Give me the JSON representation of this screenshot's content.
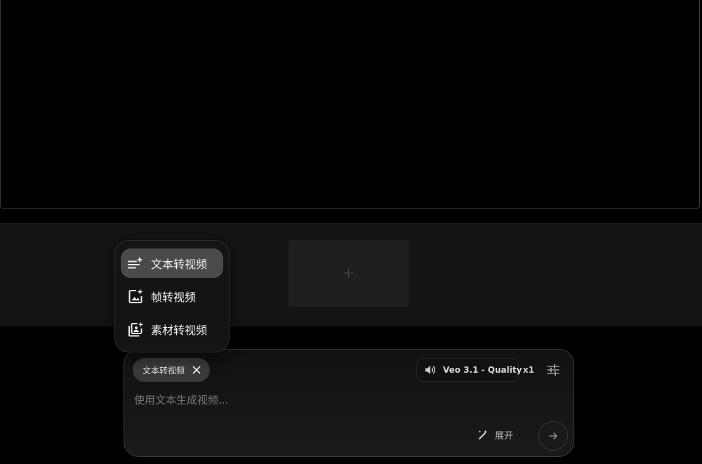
{
  "timeline": {
    "add_clip_symbol": "+"
  },
  "mode_menu": {
    "items": [
      {
        "label": "文本转视频",
        "icon": "text-sparkle-icon",
        "active": true
      },
      {
        "label": "帧转视频",
        "icon": "image-sparkle-icon",
        "active": false
      },
      {
        "label": "素材转视频",
        "icon": "assets-sparkle-icon",
        "active": false
      }
    ]
  },
  "composer": {
    "mode_chip_label": "文本转视频",
    "model_label": "Veo 3.1 - Quality",
    "count_label": "x1",
    "prompt_placeholder": "使用文本生成视频...",
    "prompt_value": "",
    "expand_label": "展开"
  },
  "colors": {
    "background": "#000000",
    "panel": "#141414",
    "active_item": "#4a4a4a",
    "chip": "#3a3a3a"
  }
}
